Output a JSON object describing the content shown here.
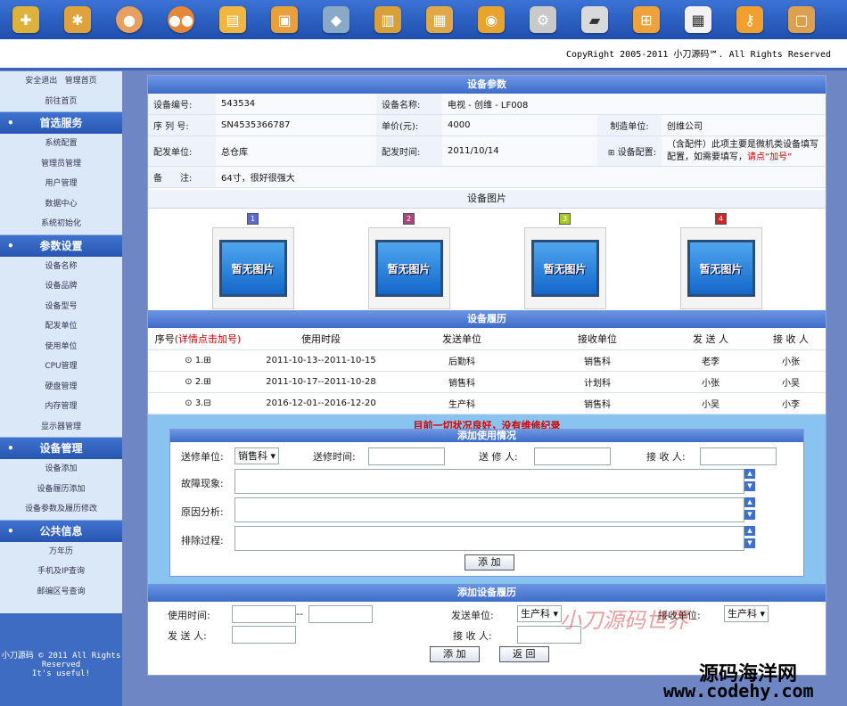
{
  "header": {
    "copyright": "CopyRight 2005-2011 小刀源码℠. All Rights Reserved"
  },
  "sidebar": {
    "top_links": [
      {
        "label": "安全退出"
      },
      {
        "label": "管理首页"
      },
      {
        "label": "前往首页"
      }
    ],
    "sections": [
      {
        "title": "首选服务",
        "items": [
          "系统配置",
          "管理员管理",
          "用户管理",
          "数据中心",
          "系统初始化"
        ]
      },
      {
        "title": "参数设置",
        "items": [
          "设备名称",
          "设备品牌",
          "设备型号",
          "配发单位",
          "使用单位",
          "CPU管理",
          "硬盘管理",
          "内存管理",
          "显示器管理"
        ]
      },
      {
        "title": "设备管理",
        "items": [
          "设备添加",
          "设备履历添加",
          "设备参数及履历修改"
        ]
      },
      {
        "title": "公共信息",
        "items": [
          "万年历",
          "手机及IP查询",
          "邮编区号查询"
        ]
      }
    ],
    "footer": {
      "line1": "小刀源码 © 2011 All Rights",
      "line2": "Reserved",
      "line3": "It's useful!"
    }
  },
  "params": {
    "title": "设备参数",
    "code_label": "设备编号:",
    "code": "543534",
    "name_label": "设备名称:",
    "name": "电视 - 创维 - LF008",
    "sn_label": "序 列 号:",
    "sn": "SN4535366787",
    "price_label": "单价(元):",
    "price": "4000",
    "maker_label": "制造单位:",
    "maker": "创维公司",
    "dist_label": "配发单位:",
    "dist": "总仓库",
    "date_label": "配发时间:",
    "date": "2011/10/14",
    "config_label": "设备配置:",
    "config_note": "（含配件）此项主要是微机类设备填写配置，如需要填写，",
    "config_link": "请点“加号”",
    "remark_label": "备　　注:",
    "remark": "64寸，很好很强大"
  },
  "images": {
    "title": "设备图片",
    "items": [
      {
        "num": "1",
        "placeholder": "暂无图片",
        "color": "#5a6bd0"
      },
      {
        "num": "2",
        "placeholder": "暂无图片",
        "color": "#b0427c"
      },
      {
        "num": "3",
        "placeholder": "暂无图片",
        "color": "#a9cc22"
      },
      {
        "num": "4",
        "placeholder": "暂无图片",
        "color": "#c8262a"
      }
    ]
  },
  "history": {
    "title": "设备履历",
    "col_seq": "序号",
    "col_seq_hint": "(详情点击加号)",
    "columns": [
      "使用时段",
      "发送单位",
      "接收单位",
      "发 送 人",
      "接 收 人"
    ],
    "rows": [
      {
        "seq": "1.",
        "period": "2011-10-13--2011-10-15",
        "from": "后勤科",
        "to": "销售科",
        "sender": "老李",
        "receiver": "小张"
      },
      {
        "seq": "2.",
        "period": "2011-10-17--2011-10-28",
        "from": "销售科",
        "to": "计划科",
        "sender": "小张",
        "receiver": "小吴"
      },
      {
        "seq": "3.",
        "period": "2016-12-01--2016-12-20",
        "from": "生产科",
        "to": "销售科",
        "sender": "小吴",
        "receiver": "小李"
      }
    ],
    "status": "目前一切状况良好，没有维修纪录"
  },
  "usage_form": {
    "title": "添加使用情况",
    "dept_label": "送修单位:",
    "dept_value": "销售科",
    "time_label": "送修时间:",
    "person_label": "送 修 人:",
    "receiver_label": "接 收 人:",
    "fault_label": "故障现象:",
    "cause_label": "原因分析:",
    "fix_label": "排除过程:",
    "add_button": "添 加"
  },
  "record_form": {
    "title": "添加设备履历",
    "time_label": "使用时间:",
    "sep": "--",
    "send_dept_label": "发送单位:",
    "send_dept_value": "生产科",
    "recv_dept_label": "接收单位:",
    "recv_dept_value": "生产科",
    "sender_label": "发 送 人:",
    "receiver_label": "接 收 人:",
    "add_button": "添 加",
    "back_button": "返 回"
  },
  "watermarks": {
    "brand": "小刀源码世界",
    "site_name": "源码海洋网",
    "site_url": "www.codehy.com"
  }
}
